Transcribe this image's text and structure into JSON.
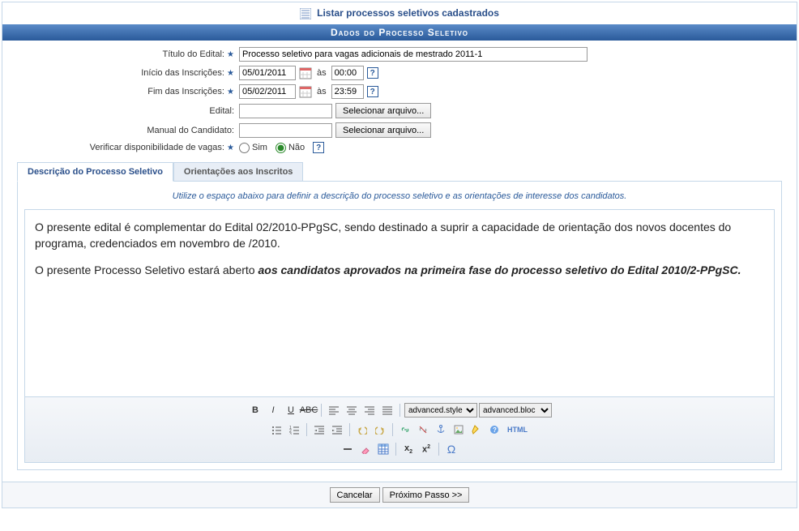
{
  "topLink": {
    "label": "Listar processos seletivos cadastrados"
  },
  "sectionHeader": "Dados do Processo Seletivo",
  "form": {
    "titleLabel": "Título do Edital:",
    "titleValue": "Processo seletivo para vagas adicionais de mestrado 2011-1",
    "startLabel": "Início das Inscrições:",
    "startDate": "05/01/2011",
    "startTime": "00:00",
    "endLabel": "Fim das Inscrições:",
    "endDate": "05/02/2011",
    "endTime": "23:59",
    "asLabel": "às",
    "editalLabel": "Edital:",
    "manualLabel": "Manual do Candidato:",
    "fileBtn": "Selecionar arquivo...",
    "availLabel": "Verificar disponibilidade de vagas:",
    "yes": "Sim",
    "no": "Não"
  },
  "tabs": {
    "desc": "Descrição do Processo Seletivo",
    "orient": "Orientações aos Inscritos"
  },
  "hint": "Utilize o espaço abaixo para definir a descrição do processo seletivo e as orientações de interesse dos candidatos.",
  "editorContent": {
    "p1a": "O presente edital é complementar do Edital 02/2010-PPgSC, sendo destinado a suprir a capacidade de orientação dos novos docentes do programa, credenciados em novembro de /2010.",
    "p2a": "O presente Processo Seletivo estará aberto ",
    "p2b": "aos candidatos aprovados na primeira fase do processo seletivo do Edital 2010/2-PPgSC."
  },
  "toolSelects": {
    "style": "advanced.style",
    "block": "advanced.bloc"
  },
  "buttons": {
    "cancel": "Cancelar",
    "next": "Próximo Passo >>"
  },
  "tooltips": {
    "bold": "Bold",
    "italic": "Italic",
    "underline": "Underline",
    "strike": "Strikethrough",
    "left": "Align Left",
    "center": "Center",
    "right": "Align Right",
    "justify": "Justify",
    "ul": "Unordered List",
    "ol": "Ordered List",
    "outdent": "Outdent",
    "indent": "Indent",
    "undo": "Undo",
    "redo": "Redo",
    "link": "Insert Link",
    "unlink": "Unlink",
    "anchor": "Anchor",
    "image": "Image",
    "clean": "Cleanup",
    "help": "Help",
    "html": "HTML",
    "hr": "Horizontal Rule",
    "remfmt": "Remove Format",
    "table": "Table",
    "sub": "Subscript",
    "sup": "Superscript",
    "char": "Special Character"
  }
}
